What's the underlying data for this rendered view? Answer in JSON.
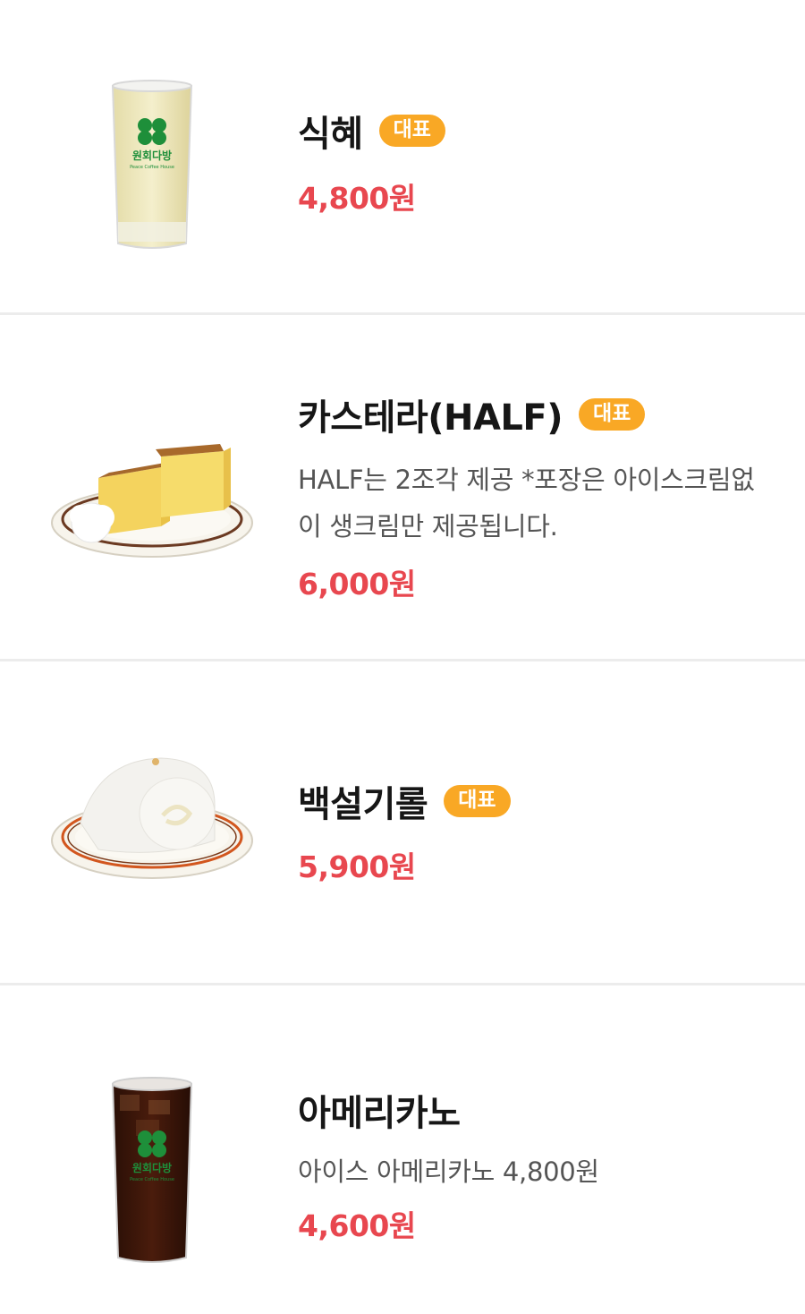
{
  "items": [
    {
      "name": "식혜",
      "badge": "대표",
      "description": "",
      "price": "4,800원",
      "image": "sikhye-glass",
      "logo_text": "원회다방",
      "logo_sub": "Peace Coffee House"
    },
    {
      "name": "카스테라(HALF)",
      "badge": "대표",
      "description": "HALF는 2조각 제공 *포장은 아이스크림없이 생크림만 제공됩니다.",
      "price": "6,000원",
      "image": "castella-plate"
    },
    {
      "name": "백설기롤",
      "badge": "대표",
      "description": "",
      "price": "5,900원",
      "image": "rice-cake-roll-plate"
    },
    {
      "name": "아메리카노",
      "badge": "",
      "description": "아이스 아메리카노 4,800원",
      "price": "4,600원",
      "image": "iced-americano-glass",
      "logo_text": "원회다방",
      "logo_sub": "Peace Coffee House"
    }
  ],
  "colors": {
    "price": "#e8474f",
    "badge": "#f9a825",
    "divider": "#ececec",
    "logo_green": "#1e8f3a"
  }
}
